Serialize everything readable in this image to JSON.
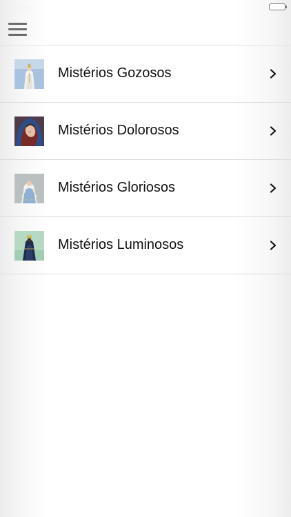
{
  "status_bar": {
    "carrier": "Carrier",
    "battery_icon": "battery-icon"
  },
  "nav_bar": {
    "menu_icon": "hamburger-menu-icon"
  },
  "list": {
    "items": [
      {
        "label": "Mistérios Gozosos",
        "thumbnail": "our-lady-of-fatima-image",
        "chevron_icon": "chevron-right-icon"
      },
      {
        "label": "Mistérios Dolorosos",
        "thumbnail": "sorrowful-virgin-image",
        "chevron_icon": "chevron-right-icon"
      },
      {
        "label": "Mistérios Gloriosos",
        "thumbnail": "miraculous-virgin-image",
        "chevron_icon": "chevron-right-icon"
      },
      {
        "label": "Mistérios Luminosos",
        "thumbnail": "our-lady-aparecida-image",
        "chevron_icon": "chevron-right-icon"
      }
    ]
  },
  "colors": {
    "text": "#111111",
    "separator": "#dcdcdc",
    "menu_icon": "#6b6b6b"
  }
}
